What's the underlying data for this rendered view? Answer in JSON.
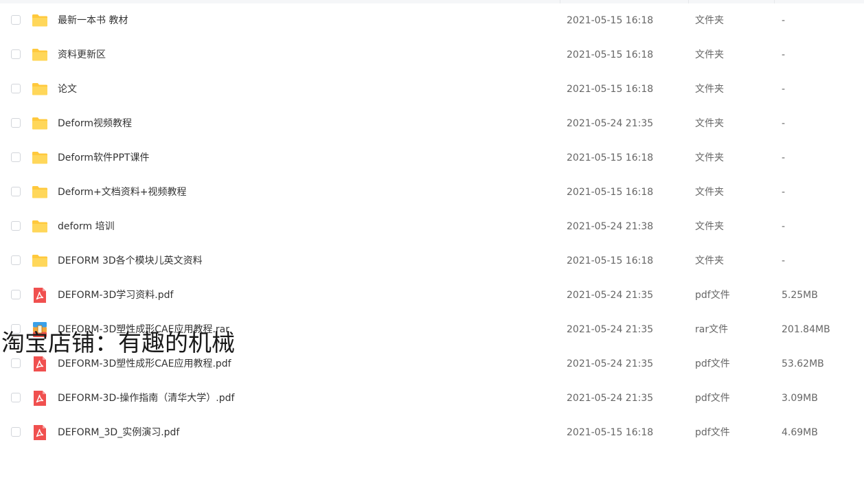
{
  "files": [
    {
      "name": "最新一本书  教材",
      "date": "2021-05-15 16:18",
      "type": "文件夹",
      "size": "-",
      "icon": "folder-icon"
    },
    {
      "name": "资料更新区",
      "date": "2021-05-15 16:18",
      "type": "文件夹",
      "size": "-",
      "icon": "folder-icon"
    },
    {
      "name": "论文",
      "date": "2021-05-15 16:18",
      "type": "文件夹",
      "size": "-",
      "icon": "folder-icon"
    },
    {
      "name": "Deform视频教程",
      "date": "2021-05-24 21:35",
      "type": "文件夹",
      "size": "-",
      "icon": "folder-icon"
    },
    {
      "name": "Deform软件PPT课件",
      "date": "2021-05-15 16:18",
      "type": "文件夹",
      "size": "-",
      "icon": "folder-icon"
    },
    {
      "name": "Deform+文档资料+视频教程",
      "date": "2021-05-15 16:18",
      "type": "文件夹",
      "size": "-",
      "icon": "folder-icon"
    },
    {
      "name": "deform 培训",
      "date": "2021-05-24 21:38",
      "type": "文件夹",
      "size": "-",
      "icon": "folder-icon"
    },
    {
      "name": "DEFORM 3D各个模块儿英文资料",
      "date": "2021-05-15 16:18",
      "type": "文件夹",
      "size": "-",
      "icon": "folder-icon"
    },
    {
      "name": "DEFORM-3D学习资料.pdf",
      "date": "2021-05-24 21:35",
      "type": "pdf文件",
      "size": "5.25MB",
      "icon": "pdf-icon"
    },
    {
      "name": "DEFORM-3D塑性成形CAE应用教程.rar",
      "date": "2021-05-24 21:35",
      "type": "rar文件",
      "size": "201.84MB",
      "icon": "rar-icon"
    },
    {
      "name": "DEFORM-3D塑性成形CAE应用教程.pdf",
      "date": "2021-05-24 21:35",
      "type": "pdf文件",
      "size": "53.62MB",
      "icon": "pdf-icon"
    },
    {
      "name": "DEFORM-3D-操作指南（清华大学）.pdf",
      "date": "2021-05-24 21:35",
      "type": "pdf文件",
      "size": "3.09MB",
      "icon": "pdf-icon"
    },
    {
      "name": "DEFORM_3D_实例演习.pdf",
      "date": "2021-05-15 16:18",
      "type": "pdf文件",
      "size": "4.69MB",
      "icon": "pdf-icon"
    }
  ],
  "watermark": "淘宝店铺：有趣的机械",
  "colors": {
    "folder": "#ffc93d",
    "pdf": "#f0504f",
    "rar_top": "#3aa0e8",
    "rar_mid": "#f2a63a",
    "rar_bottom": "#e8534a"
  }
}
